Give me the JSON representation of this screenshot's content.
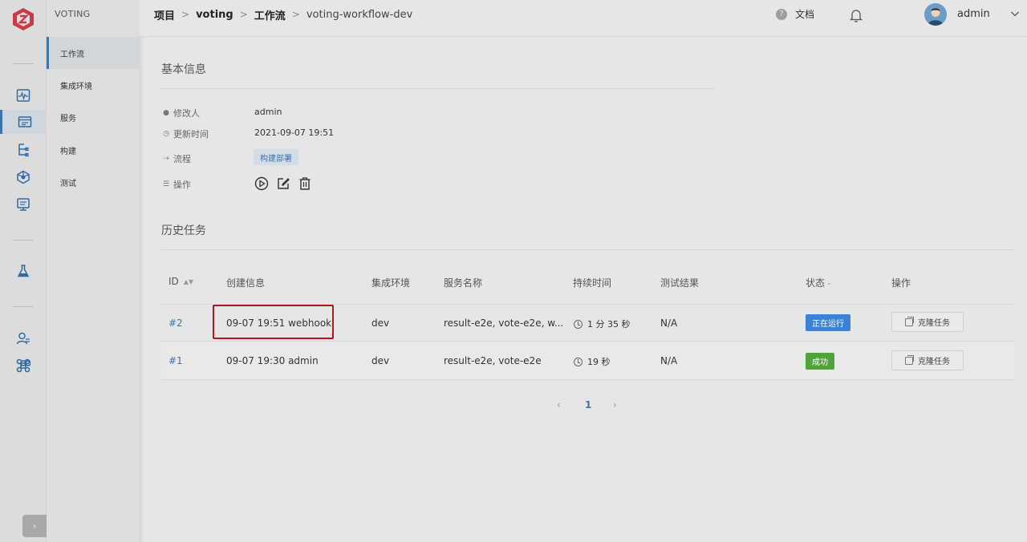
{
  "app": {
    "project_name": "VOTING",
    "brand_color": "#3f74a9"
  },
  "rail": {
    "icons": [
      "logo-icon",
      "monitor-icon",
      "project-icon",
      "pipeline-icon",
      "cube-icon",
      "quality-icon",
      "test-flask-icon",
      "user-manage-icon",
      "plugin-icon"
    ],
    "toggle": "›"
  },
  "subnav": {
    "items": [
      {
        "label": "工作流",
        "active": true
      },
      {
        "label": "集成环境"
      },
      {
        "label": "服务"
      },
      {
        "label": "构建"
      },
      {
        "label": "测试"
      }
    ]
  },
  "header": {
    "breadcrumb": [
      "项目",
      "voting",
      "工作流",
      "voting-workflow-dev"
    ],
    "sep": ">",
    "docs": "文档",
    "user": "admin"
  },
  "basic_info": {
    "title": "基本信息",
    "modifier_label": "修改人",
    "modifier": "admin",
    "updated_label": "更新时间",
    "updated": "2021-09-07 19:51",
    "flow_label": "流程",
    "flow_tag": "构建部署",
    "ops_label": "操作"
  },
  "history": {
    "title": "历史任务",
    "columns": [
      "ID",
      "创建信息",
      "集成环境",
      "服务名称",
      "持续时间",
      "测试结果",
      "状态",
      "操作"
    ],
    "rows": [
      {
        "id": "#2",
        "created": "09-07 19:51 webhook",
        "env": "dev",
        "services": "result-e2e, vote-e2e, w...",
        "duration": "1 分 35 秒",
        "test": "N/A",
        "status": "正在运行",
        "status_color": "#3b82d6",
        "action": "克隆任务"
      },
      {
        "id": "#1",
        "created": "09-07 19:30 admin",
        "env": "dev",
        "services": "result-e2e, vote-e2e",
        "duration": "19 秒",
        "test": "N/A",
        "status": "成功",
        "status_color": "#52a43a",
        "action": "克隆任务"
      }
    ]
  },
  "pagination": {
    "prev": "‹",
    "current": "1",
    "next": "›"
  }
}
